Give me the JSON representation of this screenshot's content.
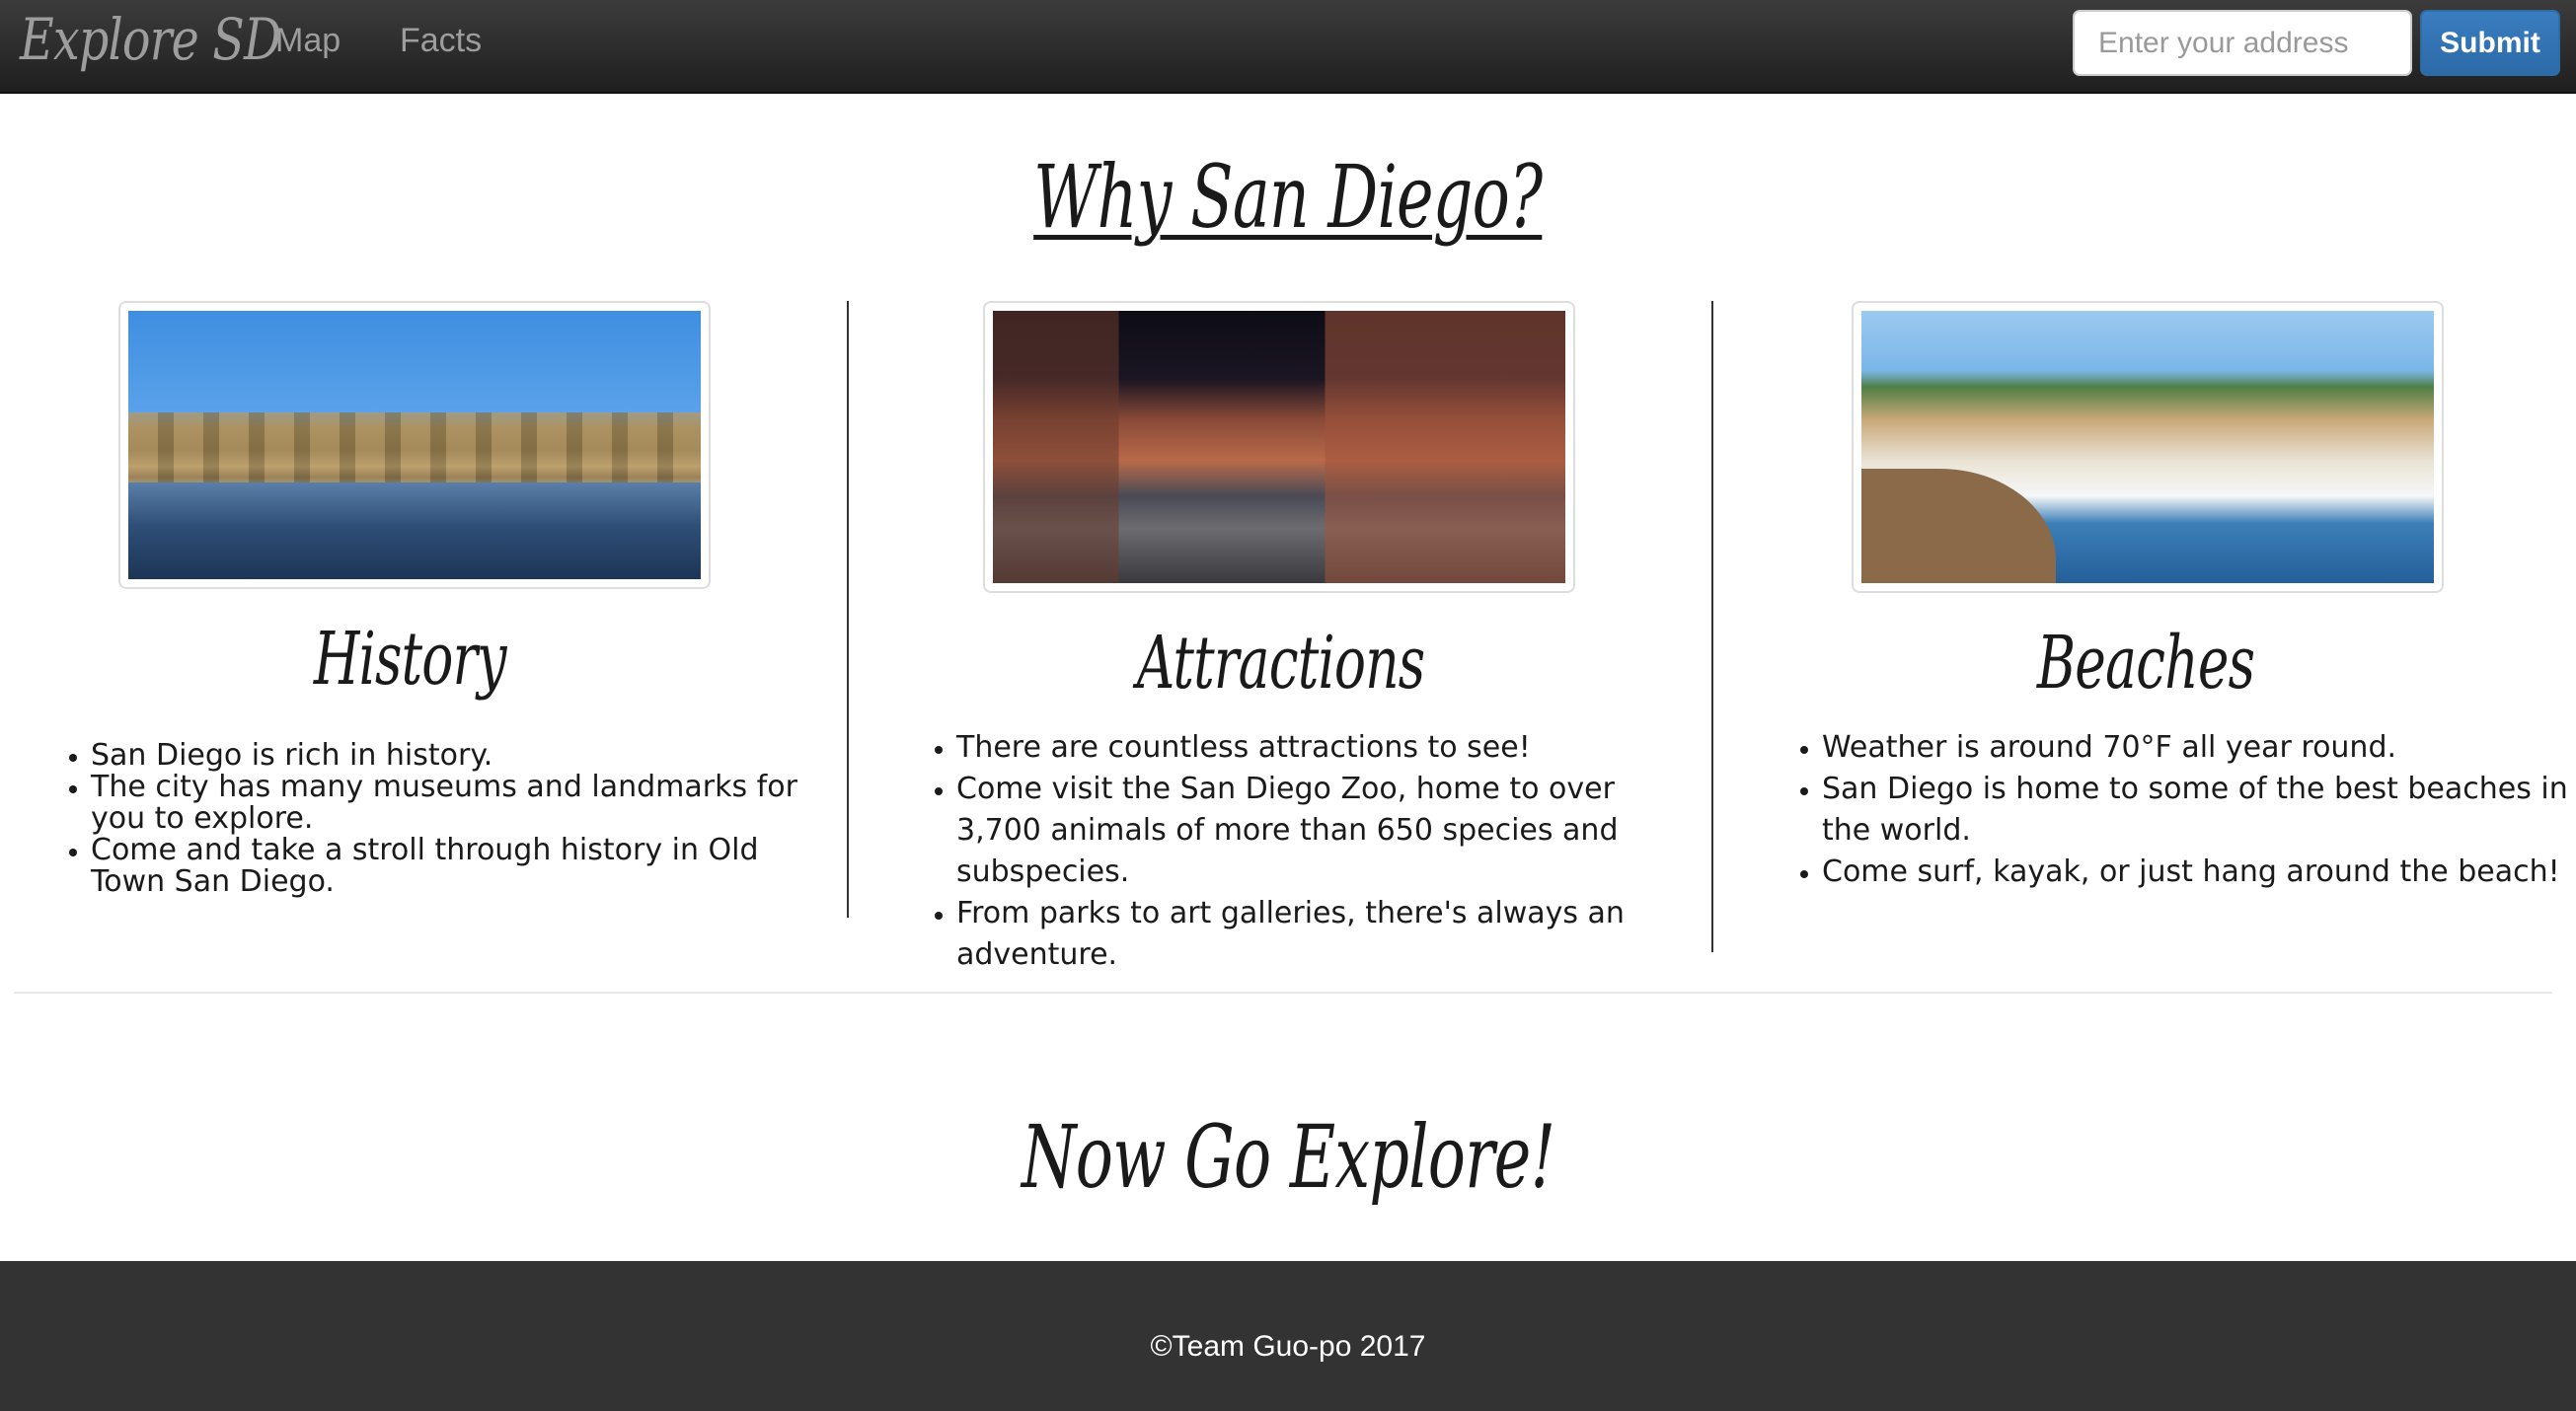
{
  "navbar": {
    "brand": "Explore SD",
    "links": [
      {
        "label": "Map"
      },
      {
        "label": "Facts"
      }
    ],
    "address_input": {
      "value": "",
      "placeholder": "Enter your address"
    },
    "submit_label": "Submit"
  },
  "main": {
    "title": "Why San Diego?",
    "columns": [
      {
        "heading": "History",
        "image": "balboa-park-reflection",
        "bullets": [
          "San Diego is rich in history.",
          "The city has many museums and landmarks for you to explore.",
          "Come and take a stroll through history in Old Town San Diego."
        ]
      },
      {
        "heading": "Attractions",
        "image": "gaslamp-quarter-night",
        "bullets": [
          "There are countless attractions to see!",
          "Come visit the San Diego Zoo, home to over 3,700 animals of more than 650 species and subspecies.",
          "From parks to art galleries, there's always an adventure."
        ]
      },
      {
        "heading": "Beaches",
        "image": "beach-surfer",
        "bullets": [
          "Weather is around 70°F all year round.",
          "San Diego is home to some of the best beaches in the world.",
          "Come surf, kayak, or just hang around the beach!"
        ]
      }
    ],
    "closing_title": "Now Go Explore!"
  },
  "footer": {
    "text": "©Team Guo-po 2017"
  }
}
